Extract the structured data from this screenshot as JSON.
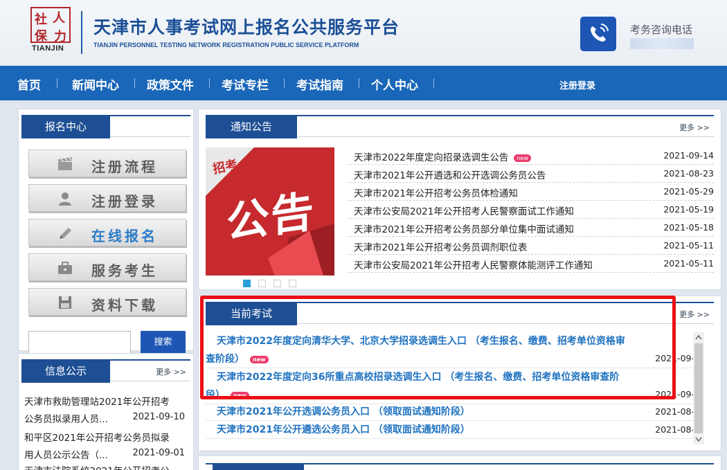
{
  "header": {
    "logo_chars": [
      "社",
      "人",
      "保",
      "力"
    ],
    "logo_en": "TIANJIN",
    "title": "天津市人事考试网上报名公共服务平台",
    "subtitle": "TIANJIN PERSONNEL TESTING NETWORK REGISTRATION PUBLIC SERVICE PLATFORM",
    "phone_label": "考务咨询电话",
    "phone_icon": "phone-icon"
  },
  "nav": {
    "items": [
      "首页",
      "新闻中心",
      "政策文件",
      "考试专栏",
      "考试指南",
      "个人中心"
    ],
    "login": "注册登录"
  },
  "signup_center": {
    "title": "报名中心",
    "buttons": [
      {
        "label": "注册流程",
        "icon": "clapper-icon",
        "active": false
      },
      {
        "label": "注册登录",
        "icon": "user-icon",
        "active": false
      },
      {
        "label": "在线报名",
        "icon": "pencil-icon",
        "active": true
      },
      {
        "label": "服务考生",
        "icon": "briefcase-icon",
        "active": false
      },
      {
        "label": "资料下载",
        "icon": "floppy-icon",
        "active": false
      }
    ],
    "search_button": "搜索"
  },
  "info_panel": {
    "title": "信息公示",
    "more": "更多 >>",
    "items": [
      {
        "line1": "天津市救助管理站2021年公开招考",
        "line2": "公务员拟录用人员...",
        "date": "2021-09-10"
      },
      {
        "line1": "和平区2021年公开招考公务员拟录",
        "line2": "用人员公示公告（...",
        "date": "2021-09-01"
      },
      {
        "line1": "天津市法院系统2021年公开招考公"
      }
    ]
  },
  "notice_panel": {
    "title": "通知公告",
    "more": "更多 >>",
    "image_text_small": "招考",
    "image_text_big": "公告",
    "items": [
      {
        "title": "天津市2022年度定向招录选调生公告",
        "date": "2021-09-14",
        "new": "new"
      },
      {
        "title": "天津市2021年公开遴选和公开选调公务员公告",
        "date": "2021-08-23"
      },
      {
        "title": "天津市2021年公开招考公务员体检通知",
        "date": "2021-05-29"
      },
      {
        "title": "天津市公安局2021年公开招考人民警察面试工作通知",
        "date": "2021-05-19"
      },
      {
        "title": "天津市2021年公开招考公务员部分单位集中面试通知",
        "date": "2021-05-18"
      },
      {
        "title": "天津市2021年公开招考公务员调剂职位表",
        "date": "2021-05-11"
      },
      {
        "title": "天津市公安局2021年公开招考人民警察体能测评工作通知",
        "date": "2021-05-11"
      }
    ]
  },
  "current_exams": {
    "title": "当前考试",
    "more": "更多 >>",
    "items": [
      {
        "line1": "天津市2022年度定向清华大学、北京大学招录选调生入口 （考生报名、缴费、招考单位资格审",
        "line2": "查阶段）",
        "new": "new",
        "date": "2021-09-"
      },
      {
        "line1": "天津市2022年度定向36所重点高校招录选调生入口 （考生报名、缴费、招考单位资格审查阶",
        "line2": "段）",
        "new": "new",
        "date": "2021-09-"
      },
      {
        "line1": "天津市2021年公开选调公务员入口 （领取面试通知阶段）",
        "date": "2021-08-"
      },
      {
        "line1": "天津市2021年公开遴选公务员入口 （领取面试通知阶段）",
        "date": "2021-08-"
      }
    ]
  },
  "colors": {
    "nav_bg": "#1a66b8",
    "panel_tab": "#1e4f94",
    "link": "#1f72c0",
    "highlight": "#ea0f16",
    "badge": "#e93c6c"
  }
}
